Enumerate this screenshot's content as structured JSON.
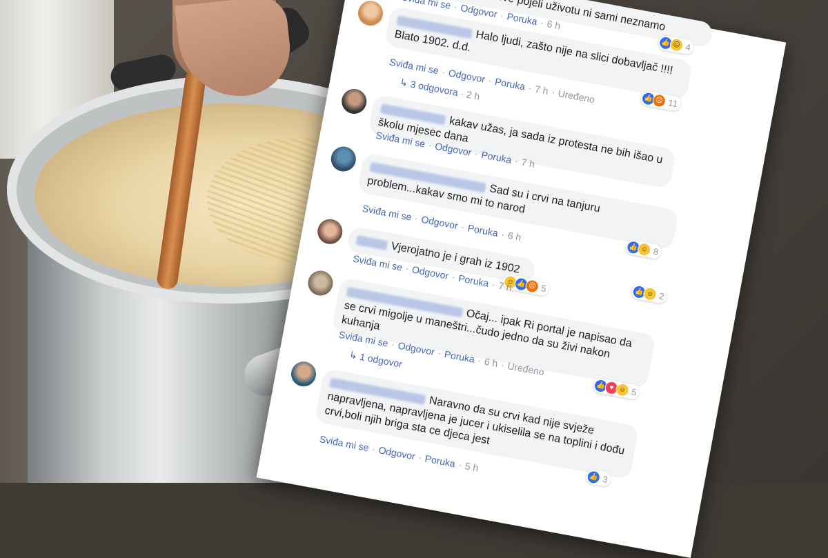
{
  "comments": [
    {
      "text": "šta smo sve pojeli uživotu ni sami neznamo",
      "actions": {
        "like": "Sviđa mi se",
        "reply": "Odgovor",
        "message": "Poruka",
        "time": "6 h"
      },
      "reactions": {
        "icons": [
          "like-icon",
          "sad-icon"
        ],
        "count": "4"
      }
    },
    {
      "text": "Halo ljudi, zašto nije na slici dobavljač !!!! Blato 1902. d.d.",
      "actions": {
        "like": "Sviđa mi se",
        "reply": "Odgovor",
        "message": "Poruka",
        "time": "7 h",
        "edited": "Uređeno"
      },
      "reactions": {
        "icons": [
          "like-icon",
          "angry-icon"
        ],
        "count": "11"
      },
      "replies": {
        "label": "3 odgovora",
        "time": "2 h"
      }
    },
    {
      "text": "kakav užas, ja sada iz protesta ne bih išao u školu mjesec dana",
      "actions": {
        "like": "Sviđa mi se",
        "reply": "Odgovor",
        "message": "Poruka",
        "time": "7 h"
      }
    },
    {
      "text": "Sad su i crvi na tanjuru problem...kakav smo mi to narod",
      "actions": {
        "like": "Sviđa mi se",
        "reply": "Odgovor",
        "message": "Poruka",
        "time": "6 h"
      },
      "reactions": {
        "icons": [
          "like-icon",
          "haha-icon"
        ],
        "count": "8"
      }
    },
    {
      "text": "Vjerojatno je i grah iz 1902",
      "actions": {
        "like": "Sviđa mi se",
        "reply": "Odgovor",
        "message": "Poruka",
        "time": "7 h"
      },
      "reactions": {
        "icons": [
          "like-icon",
          "haha-icon"
        ],
        "count": "2"
      },
      "reactions_b": {
        "icons": [
          "haha-icon",
          "like-icon",
          "angry-icon"
        ],
        "count": "5"
      }
    },
    {
      "text": "Očaj... ipak Ri portal je napisao da se crvi migolje u maneštri...čudo jedno da su živi nakon kuhanja",
      "actions": {
        "like": "Sviđa mi se",
        "reply": "Odgovor",
        "message": "Poruka",
        "time": "6 h",
        "edited": "Uređeno"
      },
      "reactions": {
        "icons": [
          "like-icon",
          "love-icon",
          "haha-icon"
        ],
        "count": "5"
      },
      "replies": {
        "label": "1 odgovor"
      }
    },
    {
      "text": "Naravno da su crvi kad nije svježe napravljena, napravljena je jucer i ukiselila se na toplini i dođu crvi,boli njih briga sta ce djeca jest",
      "actions": {
        "like": "Sviđa mi se",
        "reply": "Odgovor",
        "message": "Poruka",
        "time": "5 h"
      },
      "reactions": {
        "icons": [
          "like-icon"
        ],
        "count": "3"
      }
    }
  ]
}
